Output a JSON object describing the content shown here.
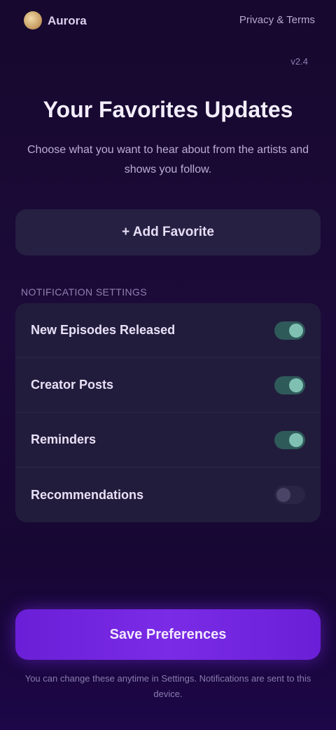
{
  "header": {
    "brand": "Aurora",
    "top_link": "Privacy & Terms",
    "version": "v2.4"
  },
  "main": {
    "title": "Your Favorites Updates",
    "subtitle": "Choose what you want to hear about from the artists and shows you follow.",
    "secondary_button": {
      "icon": "plus-icon",
      "label": "+ Add Favorite"
    },
    "section_label": "NOTIFICATION SETTINGS",
    "toggles": [
      {
        "label": "New Episodes Released",
        "on": true
      },
      {
        "label": "Creator Posts",
        "on": true
      },
      {
        "label": "Reminders",
        "on": true
      },
      {
        "label": "Recommendations",
        "on": false
      }
    ],
    "primary_button": "Save Preferences",
    "footer": "You can change these anytime in Settings. Notifications are sent to this device."
  },
  "colors": {
    "accent": "#7a2be6",
    "toggle_on": "#7fc0b2",
    "background": "#1c0b3a"
  }
}
